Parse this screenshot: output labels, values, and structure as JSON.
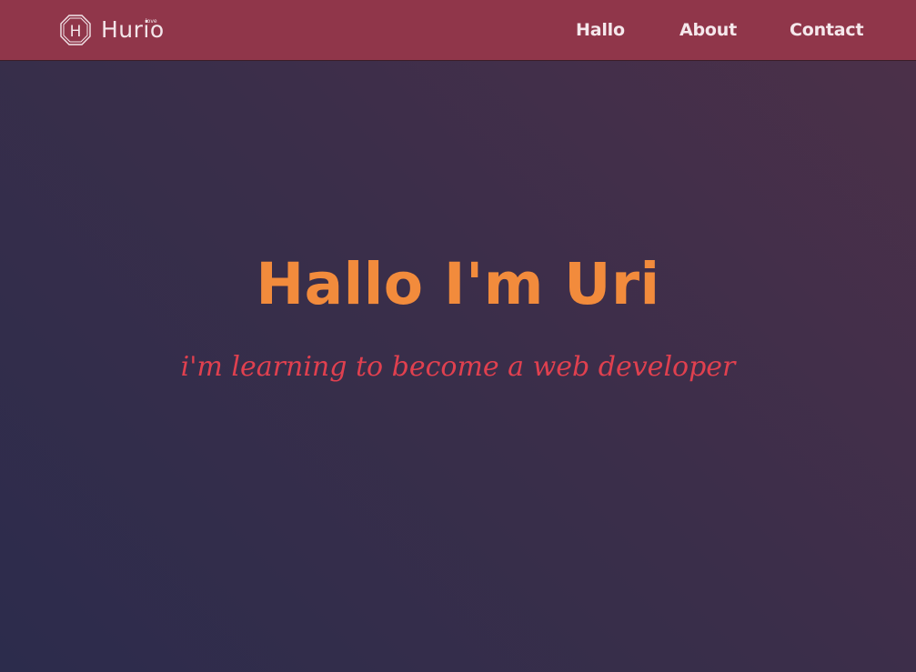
{
  "header": {
    "logo": {
      "wordmark": "Hurio",
      "badge_letter": "H",
      "superscript": "love"
    },
    "nav": [
      {
        "label": "Hallo"
      },
      {
        "label": "About"
      },
      {
        "label": "Contact"
      }
    ]
  },
  "hero": {
    "title": "Hallo I'm Uri",
    "subtitle": "i'm learning to become a web developer"
  },
  "colors": {
    "header_bg": "#90364a",
    "title": "#f28b3c",
    "subtitle": "#e0404f",
    "nav_text": "#f5e8ec"
  }
}
